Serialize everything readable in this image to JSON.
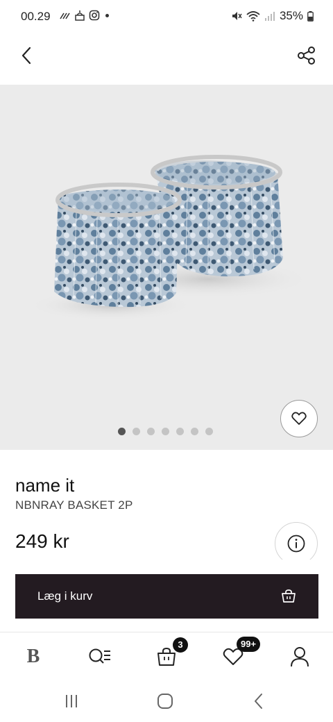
{
  "status_bar": {
    "time": "00.29",
    "battery": "35%"
  },
  "product": {
    "brand": "name it",
    "name": "NBNRAY BASKET 2P",
    "price": "249 kr",
    "image_count": 7,
    "active_image_index": 0
  },
  "actions": {
    "add_to_cart_label": "Læg i kurv"
  },
  "bottom_nav": {
    "logo": "B",
    "cart_count": "3",
    "wishlist_count": "99+"
  },
  "icons": {
    "back": "chevron-left-icon",
    "share": "share-icon",
    "favorite": "heart-icon",
    "info": "info-icon",
    "bag": "shopping-bag-icon",
    "search": "search-list-icon",
    "account": "person-icon"
  },
  "colors": {
    "primary_button": "#231b21",
    "image_background": "#ebebeb",
    "badge": "#111111"
  }
}
